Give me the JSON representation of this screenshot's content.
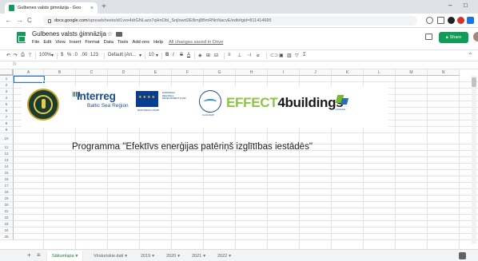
{
  "browser": {
    "tab_title": "Gulbenes valsts ģimnāzija - Goo",
    "tab_close": "×",
    "new_tab": "+",
    "url_host": "docs.google.com",
    "url_path": "/spreadsheets/d/1vxx4drGNLazx7qHnObI_Snjlowd2EBmj8BmRNnNacvE/edit#gid=811414695",
    "nav_back": "←",
    "nav_forward": "→",
    "nav_reload": "C",
    "win_min": "–",
    "win_max": "□"
  },
  "doc": {
    "title": "Gulbenes valsts ģimnāzija",
    "star": "☆",
    "menus": [
      "File",
      "Edit",
      "View",
      "Insert",
      "Format",
      "Data",
      "Tools",
      "Add-ons",
      "Help"
    ],
    "saved_status": "All changes saved in Drive",
    "share_label": "Share"
  },
  "toolbar": {
    "undo": "↶",
    "redo": "↷",
    "print": "⎙",
    "paint": "⊤",
    "zoom": "100%",
    "currency": "$",
    "percent": "%",
    "dec_less": ".0",
    "dec_more": ".00",
    "format_num": "123",
    "font": "Default (Ari...",
    "size": "10",
    "bold": "B",
    "italic": "I",
    "strike": "S",
    "text_color": "A",
    "collapse": "^"
  },
  "formula": {
    "fx": "fx"
  },
  "grid": {
    "columns": [
      "A",
      "B",
      "C",
      "D",
      "E",
      "F",
      "G",
      "H",
      "I",
      "J",
      "K",
      "L",
      "M",
      "N"
    ],
    "rows": [
      "1",
      "2",
      "3",
      "4",
      "5",
      "6",
      "7",
      "8",
      "9",
      "10",
      "11",
      "12",
      "13",
      "14",
      "15",
      "16",
      "17",
      "18",
      "19",
      "20",
      "21",
      "22",
      "23",
      "24",
      "25"
    ]
  },
  "banner": {
    "interreg": "Interreg",
    "interreg_sub": "Baltic Sea Region",
    "eu_text": "EUROPEAN REGIONAL DEVELOPMENT FUND",
    "eu_label": "EUROPEAN UNION",
    "ring_text": "FLAGSHIP",
    "effect_green": "EFFECT",
    "effect_dark": "4buildings",
    "vid_text": "VIDZEME"
  },
  "heading": "Programma \"Efektīvs enerģijas patēriņš izglītības iestādēs\"",
  "sheets": {
    "add": "+",
    "list": "≡",
    "tabs": [
      {
        "label": "Sākumlapa",
        "active": true
      },
      {
        "label": "Vēsturiskie dati",
        "active": false
      },
      {
        "label": "2019",
        "active": false
      },
      {
        "label": "2020",
        "active": false
      },
      {
        "label": "2021",
        "active": false
      },
      {
        "label": "2022",
        "active": false
      }
    ],
    "tab_caret": "▾"
  },
  "colors": {
    "sheets_green": "#0f9d58",
    "active_tab": "#188038",
    "selection": "#1a73e8",
    "effect_green": "#8cc63f",
    "interreg_blue": "#1d4d8a"
  }
}
